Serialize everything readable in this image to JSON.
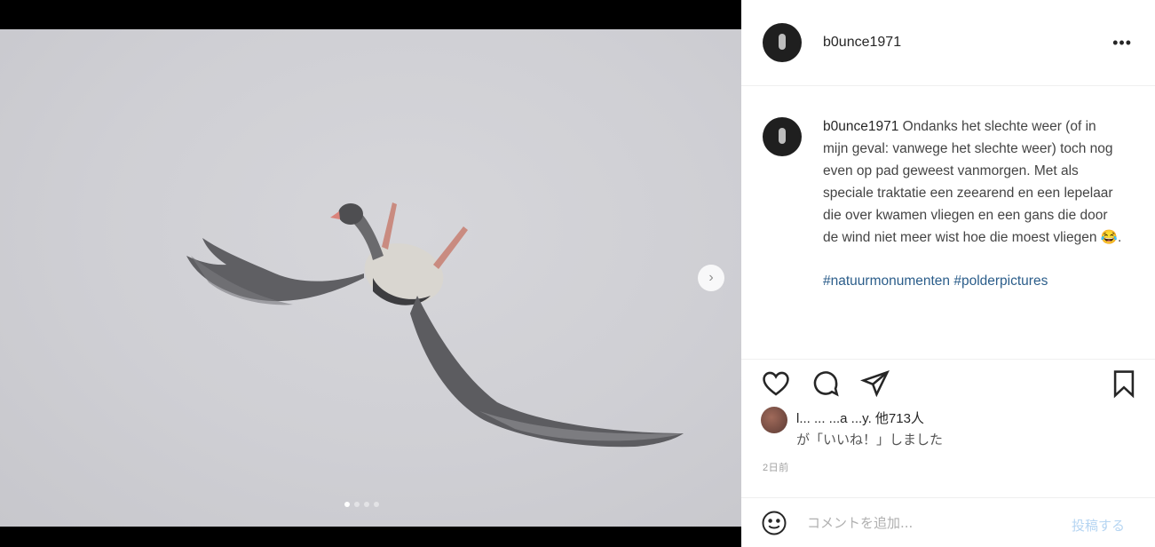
{
  "post": {
    "username": "b0unce1971",
    "more_label": "•••",
    "next_label": "›",
    "carousel_count": 4,
    "carousel_active": 0
  },
  "caption": {
    "username": "b0unce1971",
    "text": "Ondanks het slechte weer (of in mijn geval: vanwege het slechte weer) toch nog even op pad geweest vanmorgen. Met als speciale traktatie een zeearend en een lepelaar die over kwamen vliegen en een gans die door de wind niet meer wist hoe die moest vliegen 😂.",
    "hashtags": "#natuurmonumenten #polderpictures"
  },
  "likes": {
    "line1": "l... ...  ...a  ...y.  他713人",
    "line2": "が「いいね！」しました"
  },
  "date": "2日前",
  "comment": {
    "placeholder": "コメントを追加...",
    "post_label": "投稿する"
  },
  "icons": [
    "heart-icon",
    "comment-icon",
    "share-icon",
    "bookmark-icon",
    "emoji-icon",
    "more-icon",
    "chevron-right-icon"
  ]
}
